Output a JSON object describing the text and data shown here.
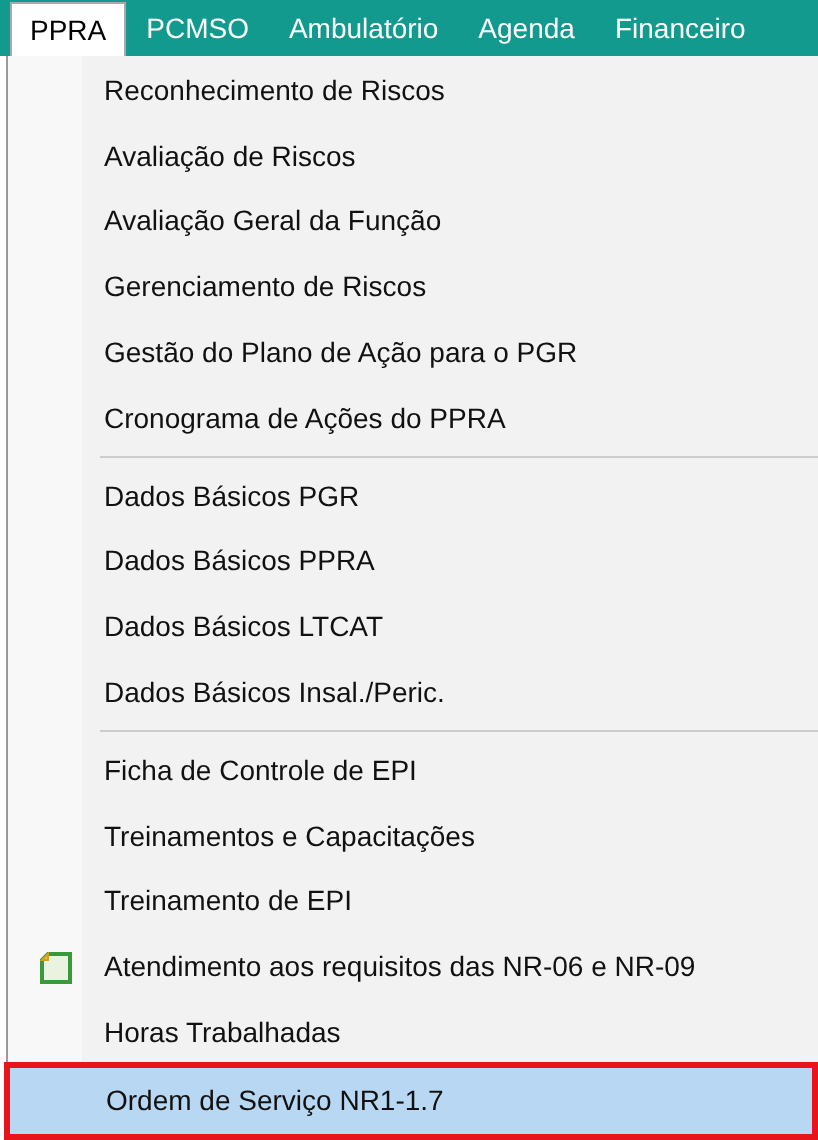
{
  "menubar": [
    {
      "label": "PPRA",
      "selected": true
    },
    {
      "label": "PCMSO",
      "selected": false
    },
    {
      "label": "Ambulatório",
      "selected": false
    },
    {
      "label": "Agenda",
      "selected": false
    },
    {
      "label": "Financeiro",
      "selected": false
    }
  ],
  "dropdown": {
    "groups": [
      {
        "items": [
          {
            "label": "Reconhecimento de Riscos",
            "selected": false,
            "outlined": false
          },
          {
            "label": "Avaliação de Riscos",
            "selected": false,
            "outlined": false
          },
          {
            "label": "Avaliação Geral da Função",
            "selected": false,
            "outlined": false
          },
          {
            "label": "Gerenciamento de Riscos",
            "selected": false,
            "outlined": false
          },
          {
            "label": "Gestão do Plano de Ação para o PGR",
            "selected": false,
            "outlined": false
          },
          {
            "label": "Cronograma de Ações do PPRA",
            "selected": false,
            "outlined": false
          }
        ]
      },
      {
        "items": [
          {
            "label": "Dados Básicos PGR",
            "selected": false,
            "outlined": false
          },
          {
            "label": "Dados Básicos PPRA",
            "selected": false,
            "outlined": false
          },
          {
            "label": "Dados Básicos LTCAT",
            "selected": false,
            "outlined": false
          },
          {
            "label": "Dados Básicos Insal./Peric.",
            "selected": false,
            "outlined": false
          }
        ]
      },
      {
        "items": [
          {
            "label": "Ficha de Controle de EPI",
            "selected": false,
            "outlined": false
          },
          {
            "label": "Treinamentos e Capacitações",
            "selected": false,
            "outlined": false
          },
          {
            "label": "Treinamento de EPI",
            "selected": false,
            "outlined": false
          },
          {
            "label": "Atendimento aos requisitos das NR-06 e NR-09",
            "selected": false,
            "outlined": false,
            "kind": "with-icon"
          },
          {
            "label": "Horas Trabalhadas",
            "selected": false,
            "outlined": false
          },
          {
            "label": "Ordem de Serviço NR1-1.7",
            "selected": true,
            "outlined": true
          }
        ]
      }
    ]
  }
}
